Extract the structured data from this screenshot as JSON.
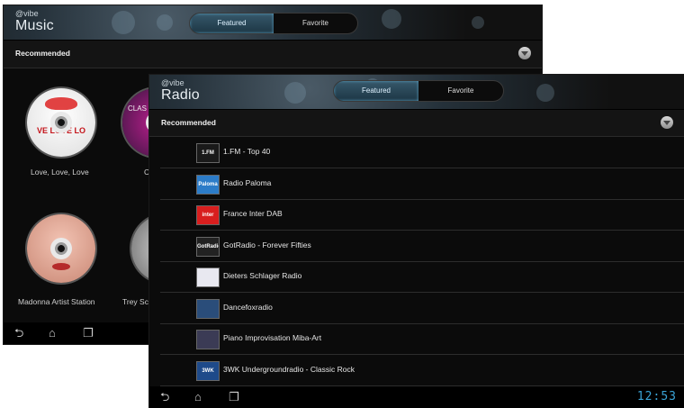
{
  "music": {
    "brand_small": "@vibe",
    "title": "Music",
    "tabs": [
      {
        "label": "Featured"
      },
      {
        "label": "Favorite"
      }
    ],
    "section": "Recommended",
    "albums": [
      {
        "label": "Love, Love, Love",
        "art_text": "VE LOVE LO"
      },
      {
        "label": "C",
        "art_text": "CLAS"
      },
      {
        "label": "Madonna Artist Station",
        "art_text": ""
      },
      {
        "label": "Trey Sc",
        "art_text": ""
      }
    ]
  },
  "radio": {
    "brand_small": "@vibe",
    "title": "Radio",
    "tabs": [
      {
        "label": "Featured"
      },
      {
        "label": "Favorite"
      }
    ],
    "section": "Recommended",
    "stations": [
      {
        "name": "1.FM - Top 40",
        "logo_text": "1.FM",
        "logo_color": "#1a1a1a"
      },
      {
        "name": "Radio Paloma",
        "logo_text": "Paloma",
        "logo_color": "#2c7cc8"
      },
      {
        "name": "France Inter DAB",
        "logo_text": "inter",
        "logo_color": "#d81e1e"
      },
      {
        "name": "GotRadio - Forever Fifties",
        "logo_text": "GotRadio",
        "logo_color": "#222222"
      },
      {
        "name": "Dieters Schlager Radio",
        "logo_text": "",
        "logo_color": "#e8e8f0"
      },
      {
        "name": "Dancefoxradio",
        "logo_text": "",
        "logo_color": "#2a4d7a"
      },
      {
        "name": "Piano Improvisation Miba-Art",
        "logo_text": "",
        "logo_color": "#3b3b55"
      },
      {
        "name": "3WK Undergroundradio - Classic Rock",
        "logo_text": "3WK",
        "logo_color": "#1e4a8a"
      }
    ],
    "clock": "12:53"
  },
  "accent_color": "#3aa3d6"
}
